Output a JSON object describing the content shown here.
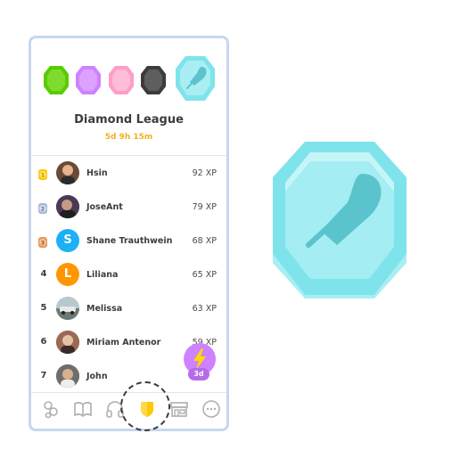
{
  "league": {
    "title": "Diamond League",
    "timer": "5d 9h 15m"
  },
  "leaderboard": [
    {
      "rank": "1",
      "name": "Hsin",
      "xp": "92 XP",
      "medal_color": "#ffc800"
    },
    {
      "rank": "2",
      "name": "JoseAnt",
      "xp": "79 XP",
      "medal_color": "#a5b8d4"
    },
    {
      "rank": "3",
      "name": "Shane Trauthwein",
      "xp": "68 XP",
      "medal_color": "#e69a5a",
      "avatar_letter": "S",
      "avatar_color": "#1cb0f6"
    },
    {
      "rank": "4",
      "name": "Liliana",
      "xp": "65 XP",
      "avatar_letter": "L",
      "avatar_color": "#ff9600"
    },
    {
      "rank": "5",
      "name": "Melissa",
      "xp": "63 XP"
    },
    {
      "rank": "6",
      "name": "Miriam Antenor",
      "xp": "59 XP"
    },
    {
      "rank": "7",
      "name": "John",
      "xp": ""
    }
  ],
  "boost": {
    "label": "3d",
    "icon": "lightning-icon"
  },
  "league_badges": [
    {
      "name": "emerald-league-icon",
      "color": "#58cc02"
    },
    {
      "name": "amethyst-league-icon",
      "color": "#ce82ff"
    },
    {
      "name": "pearl-league-icon",
      "color": "#ff9dc6"
    },
    {
      "name": "obsidian-league-icon",
      "color": "#4b4b4b"
    },
    {
      "name": "diamond-league-icon",
      "color": "#7fe3ec"
    }
  ],
  "nav_items": [
    "home-icon",
    "book-icon",
    "headphones-icon",
    "shield-icon",
    "shop-icon",
    "more-icon"
  ],
  "colors": {
    "accent_gold": "#f1b01c",
    "border": "#c6d7f0",
    "diamond": "#7fe3ec"
  }
}
